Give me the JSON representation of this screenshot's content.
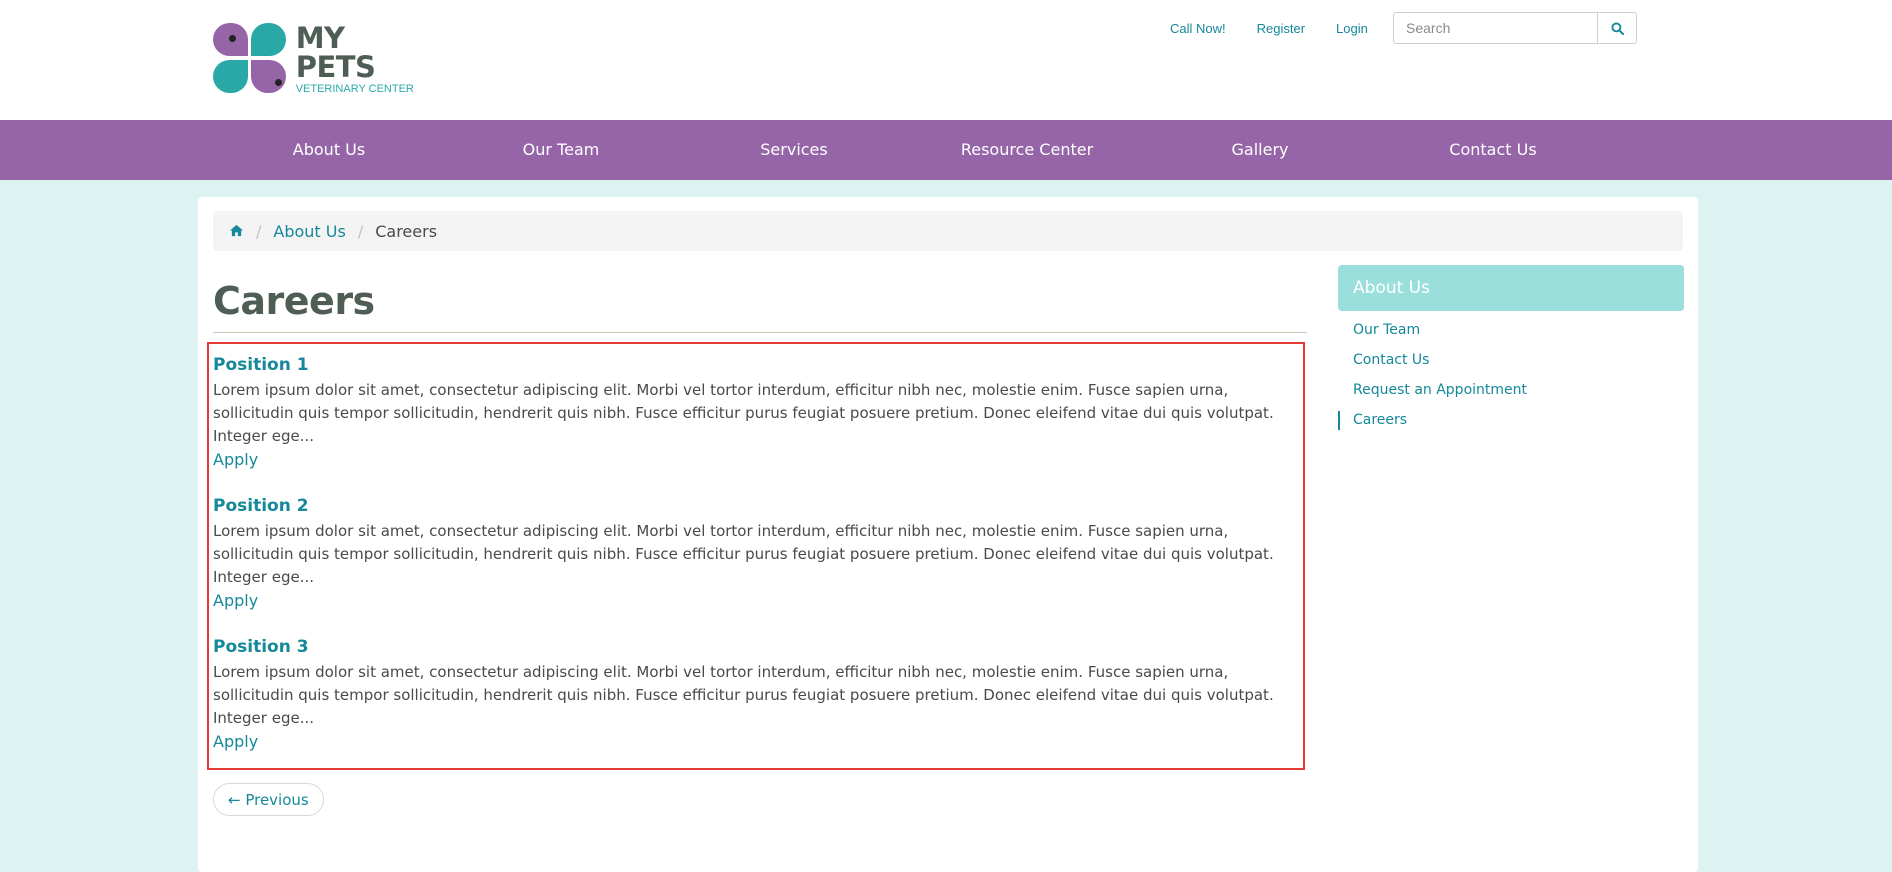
{
  "brand": {
    "title": "MY PETS",
    "subtitle": "VETERINARY CENTER"
  },
  "top_links": [
    "Call Now!",
    "Register",
    "Login"
  ],
  "search": {
    "placeholder": "Search",
    "icon": "search-icon"
  },
  "nav": [
    "About Us",
    "Our Team",
    "Services",
    "Resource Center",
    "Gallery",
    "Contact Us"
  ],
  "breadcrumb": {
    "home_icon": "home-icon",
    "items": [
      "About Us",
      "Careers"
    ]
  },
  "page": {
    "title": "Careers"
  },
  "positions": [
    {
      "title": "Position 1",
      "text": "Lorem ipsum dolor sit amet, consectetur adipiscing elit. Morbi vel tortor interdum, efficitur nibh nec, molestie enim. Fusce sapien urna, sollicitudin quis tempor sollicitudin, hendrerit quis nibh. Fusce efficitur purus feugiat posuere pretium. Donec eleifend vitae dui quis volutpat. Integer ege...",
      "link": "Apply"
    },
    {
      "title": "Position 2",
      "text": "Lorem ipsum dolor sit amet, consectetur adipiscing elit. Morbi vel tortor interdum, efficitur nibh nec, molestie enim. Fusce sapien urna, sollicitudin quis tempor sollicitudin, hendrerit quis nibh. Fusce efficitur purus feugiat posuere pretium. Donec eleifend vitae dui quis volutpat. Integer ege...",
      "link": "Apply"
    },
    {
      "title": "Position 3",
      "text": "Lorem ipsum dolor sit amet, consectetur adipiscing elit. Morbi vel tortor interdum, efficitur nibh nec, molestie enim. Fusce sapien urna, sollicitudin quis tempor sollicitudin, hendrerit quis nibh. Fusce efficitur purus feugiat posuere pretium. Donec eleifend vitae dui quis volutpat. Integer ege...",
      "link": "Apply"
    }
  ],
  "pagination": {
    "previous": "← Previous"
  },
  "sidebar": {
    "heading": "About Us",
    "items": [
      "Our Team",
      "Contact Us",
      "Request an Appointment",
      "Careers"
    ],
    "active": "Careers"
  },
  "colors": {
    "nav": "#9565a8",
    "accent": "#15889a",
    "sidebar_heading": "#9bdfdd",
    "page_bg": "#ddf3f2",
    "highlight_border": "#e53935"
  }
}
